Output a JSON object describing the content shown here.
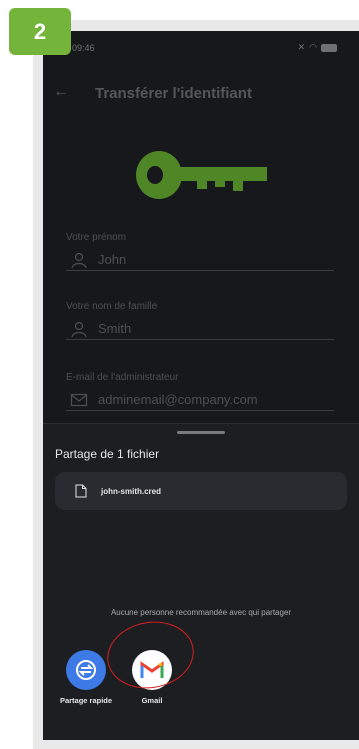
{
  "step": "2",
  "status_bar": {
    "time": "09:46"
  },
  "app_bar": {
    "title": "Transférer l'identifiant"
  },
  "form": {
    "first_name": {
      "label": "Votre prénom",
      "value": "John"
    },
    "last_name": {
      "label": "Votre nom de famille",
      "value": "Smith"
    },
    "admin_email": {
      "label": "E-mail de l'administrateur",
      "value": "adminemail@company.com"
    }
  },
  "share_sheet": {
    "title": "Partage de 1 fichier",
    "file_name": "john-smith.cred",
    "no_recommendation": "Aucune personne recommandée avec qui partager",
    "targets": [
      {
        "label": "Partage rapide",
        "icon": "quick-share-icon"
      },
      {
        "label": "Gmail",
        "icon": "gmail-icon"
      }
    ]
  },
  "colors": {
    "badge": "#74b43b",
    "key": "#5d9a2a",
    "sheet_bg": "#1d1e22",
    "highlight": "#d71e1e"
  }
}
